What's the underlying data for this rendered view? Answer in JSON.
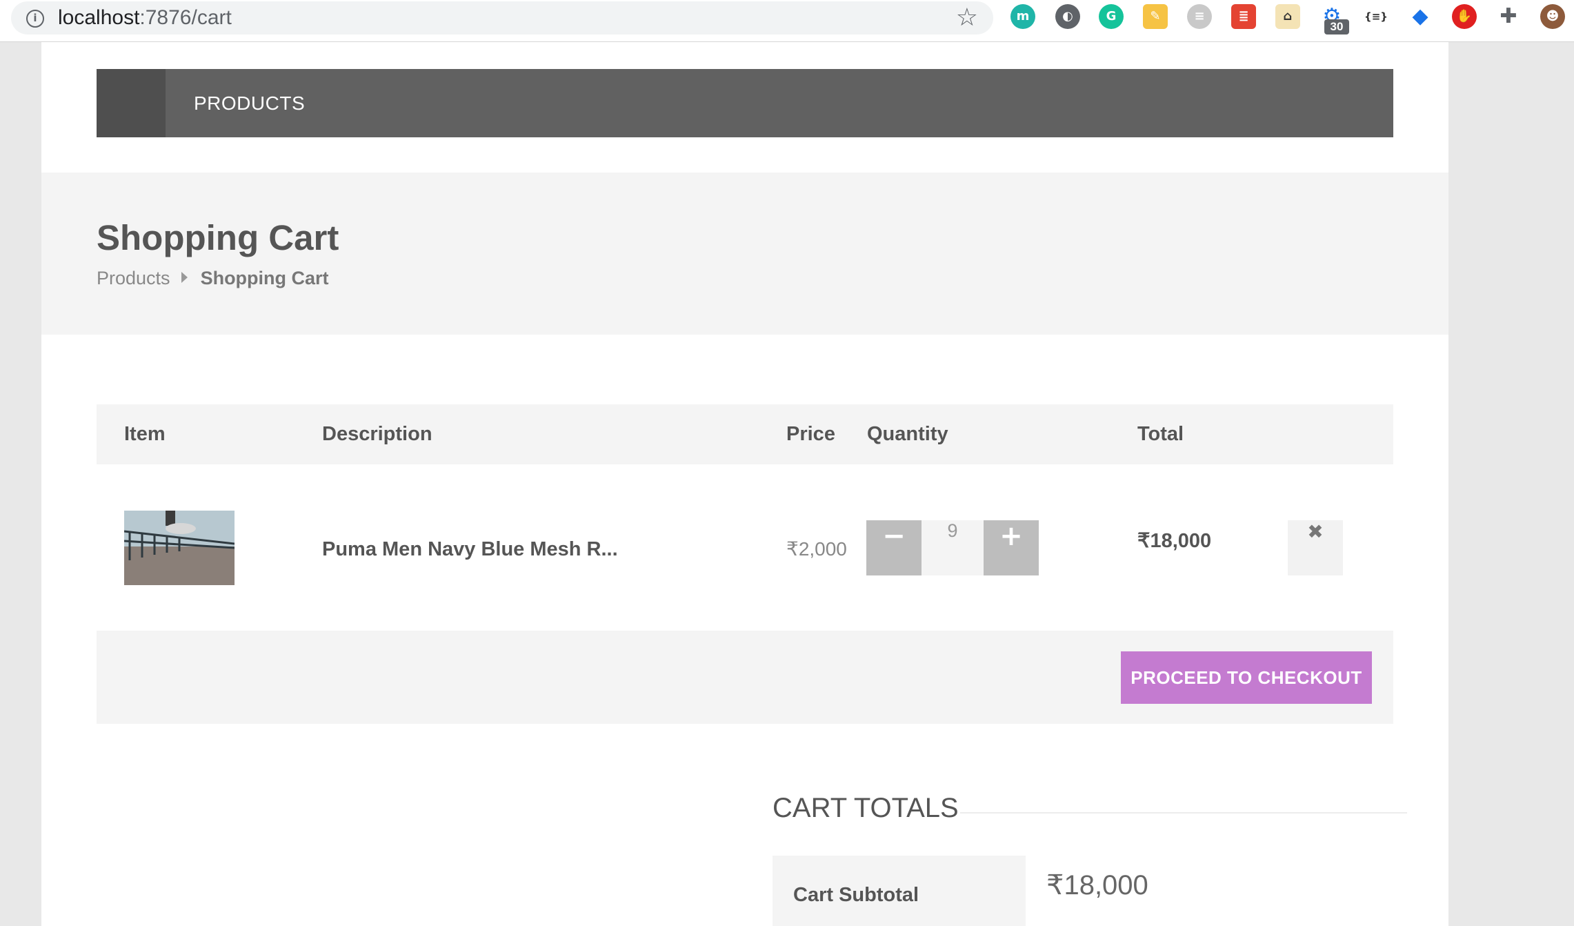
{
  "browser": {
    "url_host": "localhost",
    "url_path": ":7876/cart",
    "extension_badge": "30"
  },
  "nav": {
    "products_label": "PRODUCTS"
  },
  "hero": {
    "title": "Shopping Cart",
    "breadcrumb": [
      "Products",
      "Shopping Cart"
    ]
  },
  "table": {
    "headers": [
      "Item",
      "Description",
      "Price",
      "Quantity",
      "Total"
    ],
    "rows": [
      {
        "description": "Puma Men Navy Blue Mesh R...",
        "price": "₹2,000",
        "quantity": "9",
        "total": "₹18,000"
      }
    ]
  },
  "actions": {
    "checkout_label": "PROCEED TO CHECKOUT"
  },
  "totals": {
    "title": "CART TOTALS",
    "subtotal_label": "Cart Subtotal",
    "subtotal_value": "₹18,000"
  },
  "colors": {
    "nav_bg": "#616161",
    "checkout_bg": "#c47bd0",
    "qty_button_bg": "#bdbdbd"
  }
}
